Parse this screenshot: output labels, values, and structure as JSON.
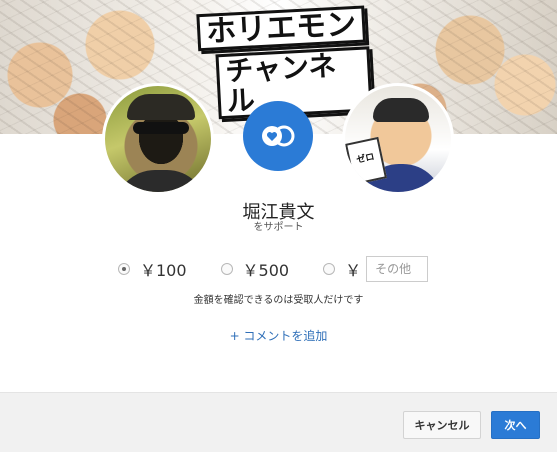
{
  "banner": {
    "logo_line1": "ホリエモン",
    "logo_line2": "チャンネル",
    "board_text": "ゼロ"
  },
  "channel": {
    "name": "堀江貴文",
    "subtitle": "をサポート"
  },
  "amounts": {
    "options": [
      {
        "label": "￥100",
        "selected": true
      },
      {
        "label": "￥500",
        "selected": false
      }
    ],
    "other_symbol": "￥",
    "other_placeholder": "その他"
  },
  "note": "金額を確認できるのは受取人だけです",
  "add_comment": "+ コメントを追加",
  "buttons": {
    "cancel": "キャンセル",
    "next": "次へ"
  },
  "colors": {
    "accent": "#2b7bd6",
    "link": "#2f6fb8",
    "footer_bg": "#f1f1f1"
  }
}
